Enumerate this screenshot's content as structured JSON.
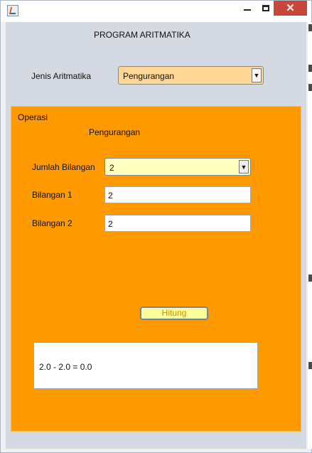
{
  "window": {
    "minimize_glyph": "",
    "maximize_glyph": "",
    "close_glyph": "✕"
  },
  "app": {
    "title": "PROGRAM ARITMATIKA"
  },
  "jenis": {
    "label": "Jenis Aritmatika",
    "selected": "Pengurangan"
  },
  "operasi": {
    "title": "Operasi",
    "subtitle": "Pengurangan",
    "jumlah_label": "Jumlah Bilangan",
    "jumlah_selected": "2",
    "bilangan1_label": "Bilangan 1",
    "bilangan1_value": "2",
    "bilangan2_label": "Bilangan 2",
    "bilangan2_value": "2",
    "hitung_label": "Hitung",
    "result_text": "2.0 - 2.0 = 0.0"
  },
  "colors": {
    "panel": "#ff9900",
    "combo_jenis": "#ffd795",
    "combo_jumlah": "#ffffc0",
    "button": "#ffff99",
    "button_text": "#d38b00",
    "close_button": "#c9473a"
  }
}
